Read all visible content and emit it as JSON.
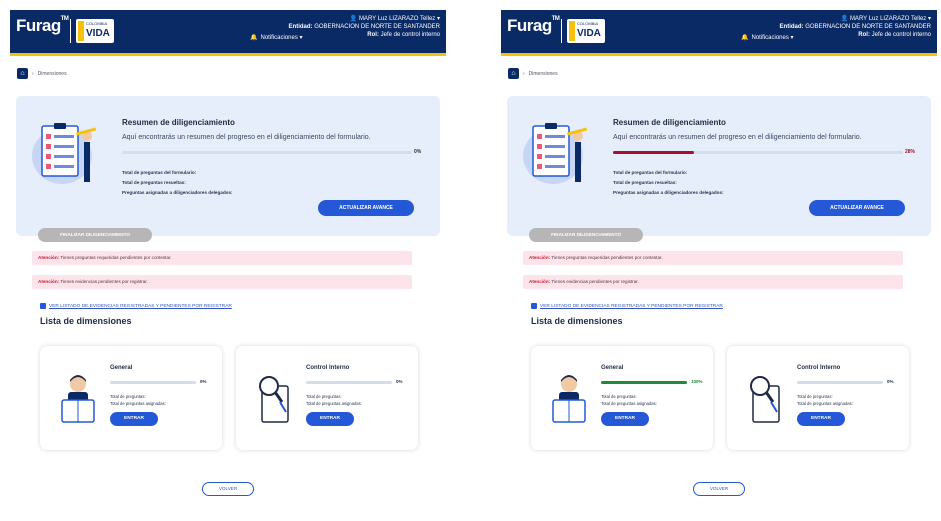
{
  "colors": {
    "navy": "#0a2a66",
    "yellow": "#f4c20d",
    "blue": "#2458d6",
    "red_progress": "#a5102a",
    "green_progress": "#1e8a3c",
    "alert_bg": "#fce4ea"
  },
  "panels": [
    {
      "header": {
        "logo": "Furag",
        "logo_small": "TM",
        "partner_small": "COLOMBIA",
        "partner": "VIDA",
        "notifications": "Notificaciones",
        "user_name": "MARY Luz LIZARAZO Tellez",
        "entity_label": "Entidad:",
        "entity": "GOBERNACION DE NORTE DE SANTANDER",
        "role_label": "Rol:",
        "role": "Jefe de control interno"
      },
      "breadcrumb": "Dimensiones",
      "summary": {
        "title": "Resumen de diligenciamiento",
        "description": "Aquí encontrarás un resumen del progreso en el diligenciamiento del formulario.",
        "progress": 0,
        "progress_label": "0%",
        "stat1": "Total de preguntas del formulario:",
        "stat2": "Total de preguntas resueltas:",
        "stat3": "Preguntas asignadas a diligenciadores delegados:",
        "update_button": "ACTUALIZAR AVANCE",
        "finish_button": "FINALIZAR DILIGENCIAMIENTO"
      },
      "alerts": [
        {
          "label": "Atención:",
          "text": "Tienes preguntas requeridas pendientes por contestar."
        },
        {
          "label": "Atención:",
          "text": "Tienes evidencias pendientes por registrar."
        }
      ],
      "evidence_link": "VER LISTADO DE EVIDENCIAS REGISTRADAS Y PENDIENTES POR REGISTRAR",
      "list_title": "Lista de dimensiones",
      "dimensions": [
        {
          "title": "General",
          "progress": 0,
          "progress_label": "0%",
          "stat1": "Total de preguntas:",
          "stat2": "Total de preguntas asignadas:",
          "button": "ENTRAR"
        },
        {
          "title": "Control Interno",
          "progress": 0,
          "progress_label": "0%",
          "stat1": "Total de preguntas:",
          "stat2": "Total de preguntas asignadas:",
          "button": "ENTRAR"
        }
      ],
      "back_button": "VOLVER"
    },
    {
      "header": {
        "logo": "Furag",
        "logo_small": "TM",
        "partner_small": "COLOMBIA",
        "partner": "VIDA",
        "notifications": "Notificaciones",
        "user_name": "MARY Luz LIZARAZO Tellez",
        "entity_label": "Entidad:",
        "entity": "GOBERNACION DE NORTE DE SANTANDER",
        "role_label": "Rol:",
        "role": "Jefe de control interno"
      },
      "breadcrumb": "Dimensiones",
      "summary": {
        "title": "Resumen de diligenciamiento",
        "description": "Aquí encontrarás un resumen del progreso en el diligenciamiento del formulario.",
        "progress": 28,
        "progress_label": "28%",
        "stat1": "Total de preguntas del formulario:",
        "stat2": "Total de preguntas resueltas:",
        "stat3": "Preguntas asignadas a diligenciadores delegados:",
        "update_button": "ACTUALIZAR AVANCE",
        "finish_button": "FINALIZAR DILIGENCIAMIENTO"
      },
      "alerts": [
        {
          "label": "Atención:",
          "text": "Tienes preguntas requeridas pendientes por contestar."
        },
        {
          "label": "Atención:",
          "text": "Tienes evidencias pendientes por registrar."
        }
      ],
      "evidence_link": "VER LISTADO DE EVIDENCIAS REGISTRADAS Y PENDIENTES POR REGISTRAR",
      "list_title": "Lista de dimensiones",
      "dimensions": [
        {
          "title": "General",
          "progress": 100,
          "progress_label": "100%",
          "stat1": "Total de preguntas:",
          "stat2": "Total de preguntas asignadas:",
          "button": "ENTRAR"
        },
        {
          "title": "Control Interno",
          "progress": 0,
          "progress_label": "0%",
          "stat1": "Total de preguntas:",
          "stat2": "Total de preguntas asignadas:",
          "button": "ENTRAR"
        }
      ],
      "back_button": "VOLVER"
    }
  ]
}
